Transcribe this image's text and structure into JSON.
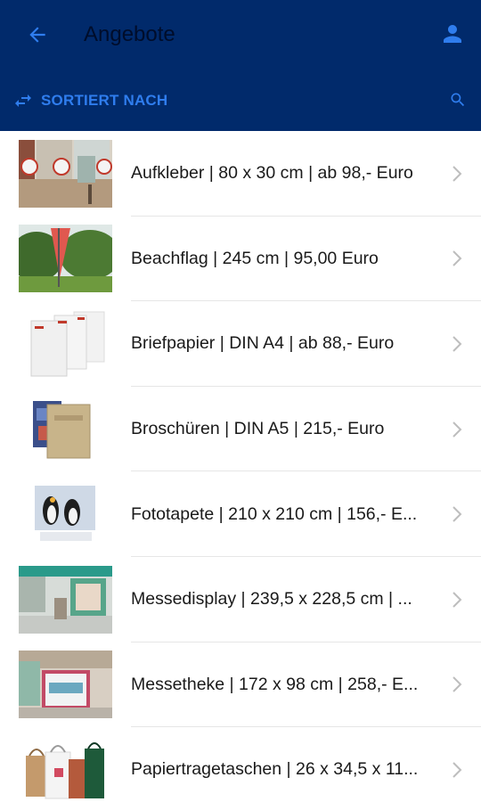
{
  "header": {
    "title": "Angebote",
    "sort_label": "SORTIERT NACH",
    "icons": {
      "back": "arrow-left-icon",
      "user": "person-icon",
      "sort": "swap-arrows-icon",
      "search": "search-icon",
      "chevron": "chevron-right-icon"
    },
    "colors": {
      "appbar": "#012a6b",
      "accent": "#2f7dee",
      "title": "#000d2b"
    }
  },
  "items": [
    {
      "label": "Aufkleber | 80 x 30 cm | ab 98,- Euro"
    },
    {
      "label": "Beachflag | 245 cm | 95,00 Euro"
    },
    {
      "label": "Briefpapier | DIN A4 | ab 88,- Euro"
    },
    {
      "label": "Broschüren | DIN A5 | 215,- Euro"
    },
    {
      "label": "Fototapete | 210 x 210 cm | 156,- E..."
    },
    {
      "label": "Messedisplay | 239,5 x 228,5 cm | ..."
    },
    {
      "label": "Messetheke | 172 x 98 cm | 258,- E..."
    },
    {
      "label": "Papiertragetaschen | 26 x 34,5 x 11..."
    }
  ]
}
